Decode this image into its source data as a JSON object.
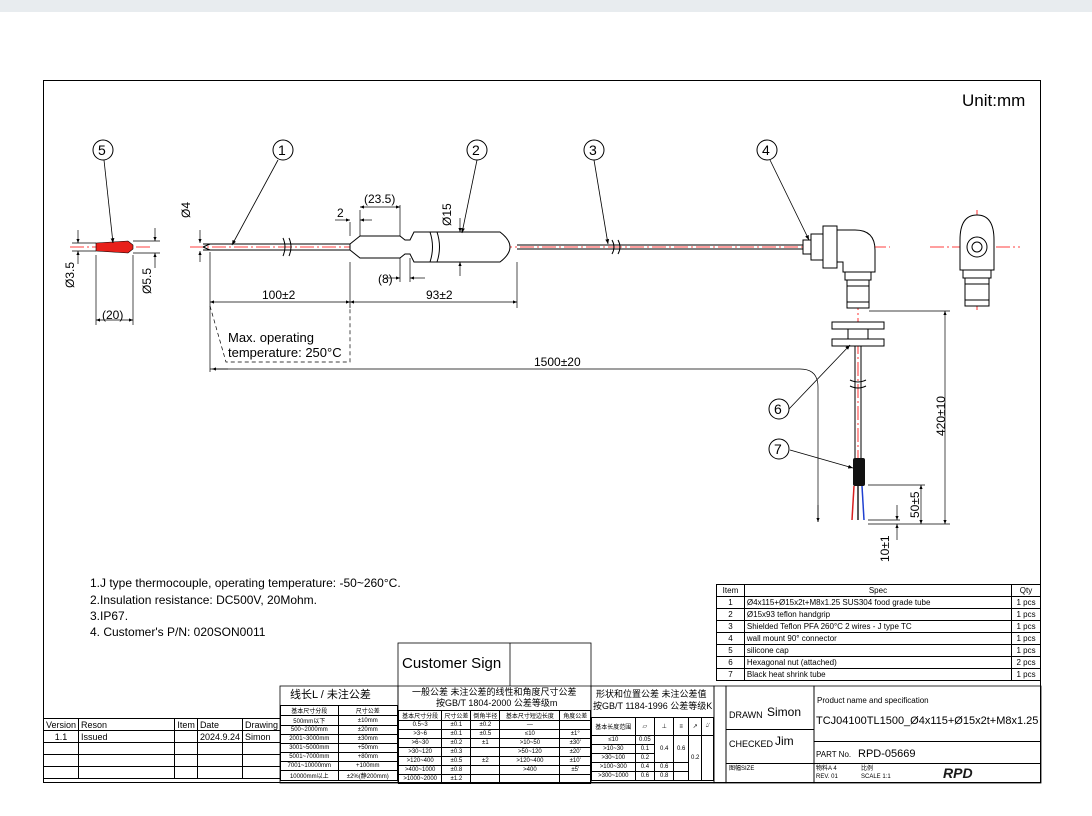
{
  "unit": "Unit:mm",
  "balloons": [
    "5",
    "1",
    "2",
    "3",
    "4",
    "6",
    "7"
  ],
  "dims": {
    "d4": "Ø4",
    "d15": "Ø15",
    "d35": "Ø3.5",
    "d55": "Ø5.5",
    "d20": "(20)",
    "d2": "2",
    "d235": "(23.5)",
    "d8": "(8)",
    "d100": "100±2",
    "d93": "93±2",
    "d1500": "1500±20",
    "d420": "420±10",
    "d50": "50±5",
    "d10": "10±1"
  },
  "note_temp": [
    "Max. operating",
    "temperature: 250°C"
  ],
  "notes": [
    "1.J type thermocouple, operating temperature: -50~260°C.",
    "2.Insulation resistance: DC500V, 20Mohm.",
    "3.IP67.",
    "4. Customer's P/N: 020SON0011"
  ],
  "parts": {
    "headers": [
      "Item",
      "Spec",
      "Qty"
    ],
    "rows": [
      [
        "1",
        "Ø4x115+Ø15x2t+M8x1.25 SUS304 food grade tube",
        "1 pcs"
      ],
      [
        "2",
        "Ø15x93 teflon handgrip",
        "1 pcs"
      ],
      [
        "3",
        "Shielded Teflon PFA 260°C 2 wires - J type TC",
        "1 pcs"
      ],
      [
        "4",
        "wall mount 90° connector",
        "1 pcs"
      ],
      [
        "5",
        "silicone cap",
        "1 pcs"
      ],
      [
        "6",
        "Hexagonal nut (attached)",
        "2 pcs"
      ],
      [
        "7",
        "Black heat shrink tube",
        "1 pcs"
      ]
    ]
  },
  "revisions": {
    "headers": [
      "Version",
      "Reson",
      "Item",
      "Date",
      "Drawing"
    ],
    "rows": [
      [
        "1.1",
        "Issued",
        "",
        "2024.9.24",
        "Simon"
      ],
      [
        "",
        "",
        "",
        "",
        ""
      ],
      [
        "",
        "",
        "",
        "",
        ""
      ],
      [
        "",
        "",
        "",
        "",
        ""
      ]
    ]
  },
  "customer_sign": "Customer Sign",
  "tol_linear": {
    "title": "线长L / 未注公差",
    "col1": "基本尺寸分段",
    "col2": "尺寸公差",
    "rows": [
      [
        "500mm以下",
        "±10mm"
      ],
      [
        "500~2000mm",
        "±20mm"
      ],
      [
        "2001~3000mm",
        "±30mm"
      ],
      [
        "3001~5000mm",
        "+50mm"
      ],
      [
        "5001~7000mm",
        "+80mm"
      ],
      [
        "7001~10000mm",
        "+100mm"
      ],
      [
        "10000mm以上",
        "±2%(静200mm)"
      ]
    ]
  },
  "tol_general": {
    "title1": "一般公差 未注公差的线性和角度尺寸公差",
    "title2": "按GB/T 1804-2000 公差等级m",
    "headers": [
      "基本尺寸分段",
      "尺寸公差",
      "倒角半径",
      "基本尺寸短边长度",
      "角度公差"
    ],
    "rows": [
      [
        "0.5~3",
        "±0.1",
        "±0.2",
        "—",
        ""
      ],
      [
        ">3~6",
        "±0.1",
        "±0.5",
        "≤10",
        "±1°"
      ],
      [
        ">6~30",
        "±0.2",
        "±1",
        ">10~50",
        "±30'"
      ],
      [
        ">30~120",
        "±0.3",
        "",
        ">50~120",
        "±20'"
      ],
      [
        ">120~400",
        "±0.5",
        "±2",
        ">120~400",
        "±10'"
      ],
      [
        ">400~1000",
        "±0.8",
        "",
        ">400",
        "±5'"
      ],
      [
        ">1000~2000",
        "±1.2",
        "",
        "",
        ""
      ]
    ]
  },
  "tol_form": {
    "title1": "形状和位置公差 未注公差值",
    "title2": "按GB/T 1184-1996 公差等级K",
    "header": "基本长度范围",
    "rows": [
      [
        "≤10",
        "0.05"
      ],
      [
        ">10~30",
        "0.1"
      ],
      [
        ">30~100",
        "0.2"
      ],
      [
        ">100~300",
        "0.4"
      ],
      [
        ">300~1000",
        "0.6"
      ]
    ],
    "c_flat": "0.4",
    "c_perp": "0.6",
    "c_sym": "0.6",
    "c_run": "0.2",
    "c_end": "0.8"
  },
  "title_block": {
    "drawn_label": "DRAWN",
    "drawn": "Simon",
    "checked_label": "CHECKED",
    "checked": "Jim",
    "product_label": "Product name and specification",
    "product": "TCJ04100TL1500_Ø4x115+Ø15x2t+M8x1.25",
    "part_label": "PART No.",
    "part": "RPD-05669",
    "size": "图幅SIZE",
    "sheet_label": "物料A 4",
    "scale_label": "比例",
    "rev": "REV. 01",
    "scale": "SCALE 1:1",
    "logo": "RPD"
  },
  "colors": {
    "centerline": "#ff0000",
    "cap": "#e8201a",
    "line": "#000000",
    "sleeve": "#111111"
  }
}
